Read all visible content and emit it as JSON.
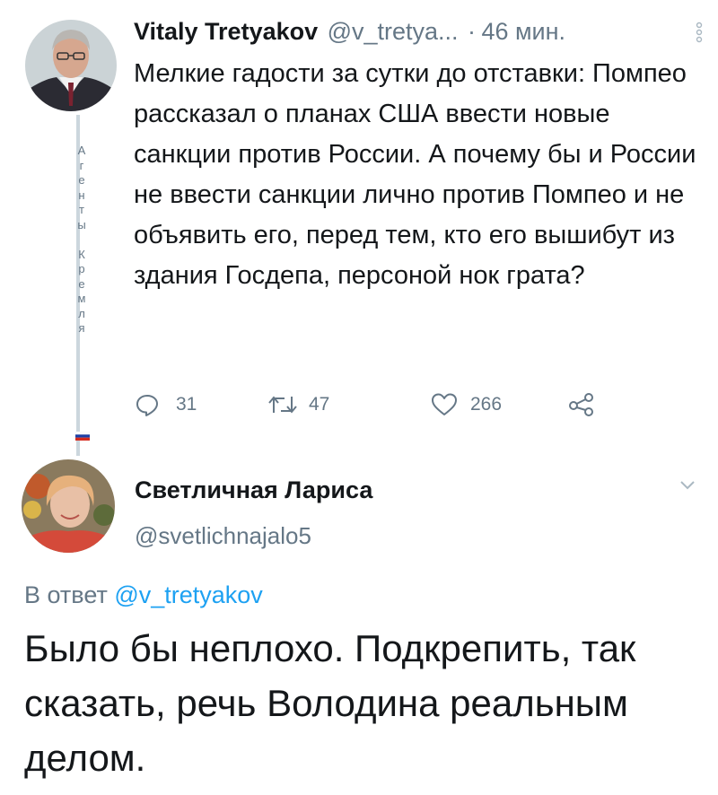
{
  "tweet": {
    "author_name": "Vitaly Tretyakov",
    "author_handle": "@v_tretya...",
    "separator": "·",
    "time": "46 мин.",
    "text": "Мелкие гадости за сутки до отставки: Помпео рассказал о планах США ввести новые санкции против России. А почему бы и России  не ввести санкции лично против Помпео и не объявить его, перед тем, кто его вышибут из здания Госдепа, персоной нок грата?",
    "reply_count": "31",
    "retweet_count": "47",
    "like_count": "266"
  },
  "watermark": {
    "letters": [
      "А",
      "г",
      "е",
      "н",
      "т",
      "ы",
      "",
      "К",
      "р",
      "е",
      "м",
      "л",
      "я"
    ]
  },
  "reply_tweet": {
    "author_name": "Светличная Лариса",
    "author_handle": "@svetlichnajalo5",
    "reply_prefix": "В ответ",
    "reply_to": "@v_tretyakov",
    "text": "Было бы неплохо. Подкрепить, так сказать, речь Володина реальным делом."
  },
  "icons": [
    "more-icon",
    "reply-icon",
    "retweet-icon",
    "like-icon",
    "share-icon",
    "chevron-down-icon",
    "russia-flag-icon"
  ],
  "colors": {
    "text": "#14171a",
    "secondary": "#657786",
    "link": "#1da1f2",
    "thread_line": "#ccd6dd"
  }
}
